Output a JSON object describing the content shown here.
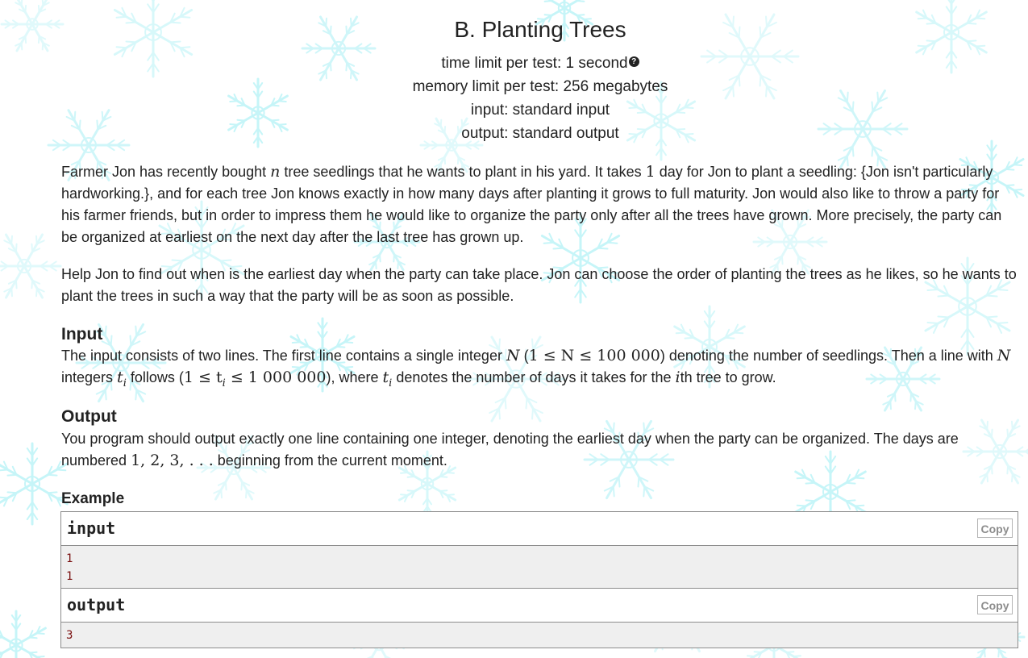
{
  "header": {
    "title": "B. Planting Trees",
    "time_limit": "time limit per test: 1 second",
    "memory_limit": "memory limit per test: 256 megabytes",
    "input": "input: standard input",
    "output": "output: standard output"
  },
  "statement": {
    "p1": {
      "a": "Farmer Jon has recently bought ",
      "n": "n",
      "b": " tree seedlings that he wants to plant in his yard. It takes ",
      "one": "1",
      "c": " day for Jon to plant a seedling: {Jon isn't particularly hardworking.}, and for each tree Jon knows exactly in how many days after planting it grows to full maturity. Jon would also like to throw a party for his farmer friends, but in order to impress them he would like to organize the party only after all the trees have grown. More precisely, the party can be organized at earliest on the next day after the last tree has grown up."
    },
    "p2": "Help Jon to find out when is the earliest day when the party can take place. Jon can choose the order of planting the trees as he likes, so he wants to plant the trees in such a way that the party will be as soon as possible."
  },
  "input_section": {
    "title": "Input",
    "a": "The input consists of two lines. The first line contains a single integer ",
    "N1": "N",
    "b": " (",
    "range1": "1 ≤ N ≤ 100 000",
    "c": ") denoting the number of seedlings. Then a line with ",
    "N2": "N",
    "d": " integers ",
    "ti1": "t",
    "e": " follows (",
    "range2": "1 ≤ t",
    "range2b": " ≤ 1 000 000",
    "f": "), where ",
    "ti2": "t",
    "g": " denotes the number of days it takes for the ",
    "i": "i",
    "h": "th tree to grow.",
    "sub_i": "i"
  },
  "output_section": {
    "title": "Output",
    "a": "You program should output exactly one line containing one integer, denoting the earliest day when the party can be organized. The days are numbered ",
    "seq": "1, 2, 3, . . .",
    "b": " beginning from the current moment."
  },
  "example": {
    "title": "Example",
    "input_label": "input",
    "output_label": "output",
    "copy_label": "Copy",
    "input_lines": [
      "1",
      "1"
    ],
    "output_lines": [
      "3"
    ]
  }
}
